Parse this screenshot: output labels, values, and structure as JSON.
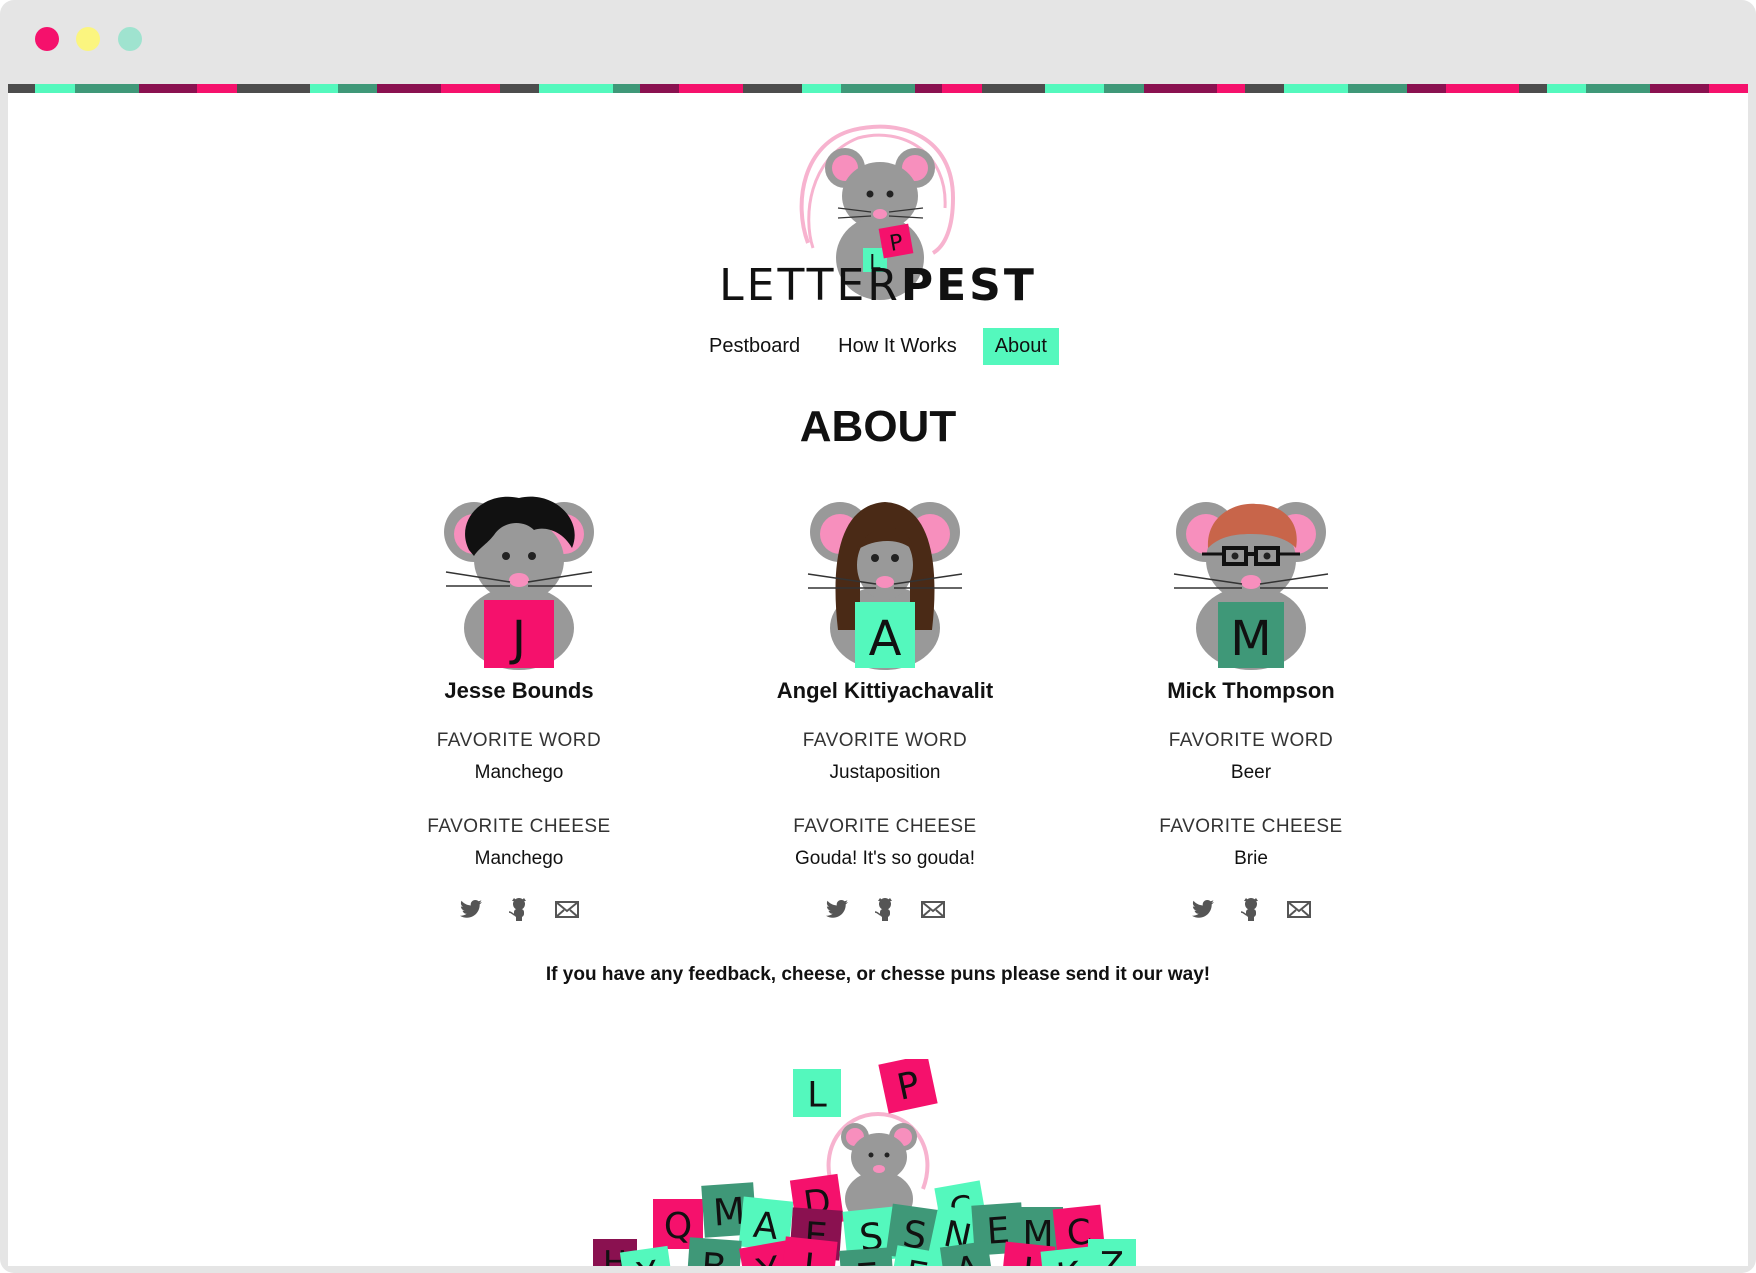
{
  "window": {
    "controls": [
      "close",
      "minimize",
      "zoom"
    ],
    "colors": {
      "close": "#f5116c",
      "minimize": "#fbf57f",
      "zoom": "#9fe3cf"
    }
  },
  "brand": {
    "wordmark_light": "LETTER",
    "wordmark_bold": "PEST",
    "logo_letters": [
      "L",
      "P"
    ],
    "colors": {
      "pink": "#f5116c",
      "mint": "#54f8bd",
      "green": "#3f9878",
      "maroon": "#8a1150",
      "gray": "#4d4d4d"
    }
  },
  "nav": {
    "items": [
      {
        "label": "Pestboard",
        "active": false
      },
      {
        "label": "How It Works",
        "active": false
      },
      {
        "label": "About",
        "active": true
      }
    ]
  },
  "main": {
    "title": "ABOUT",
    "members": [
      {
        "name": "Jesse Bounds",
        "letter": "J",
        "word_label": "FAVORITE WORD",
        "word": "Manchego",
        "cheese_label": "FAVORITE CHEESE",
        "cheese": "Manchego",
        "socials": [
          "twitter-icon",
          "github-icon",
          "mail-icon"
        ]
      },
      {
        "name": "Angel Kittiyachavalit",
        "letter": "A",
        "word_label": "FAVORITE WORD",
        "word": "Justaposition",
        "cheese_label": "FAVORITE CHEESE",
        "cheese": "Gouda! It's so gouda!",
        "socials": [
          "twitter-icon",
          "github-icon",
          "mail-icon"
        ]
      },
      {
        "name": "Mick Thompson",
        "letter": "M",
        "word_label": "FAVORITE WORD",
        "word": "Beer",
        "cheese_label": "FAVORITE CHEESE",
        "cheese": "Brie",
        "socials": [
          "twitter-icon",
          "github-icon",
          "mail-icon"
        ]
      }
    ],
    "feedback": "If you have any feedback, cheese, or chesse puns please send it our way!"
  },
  "footer_pile": {
    "held_letters": [
      "L",
      "P"
    ],
    "pile_letters": [
      "Q",
      "M",
      "A",
      "D",
      "E",
      "S",
      "S",
      "C",
      "N",
      "E",
      "M",
      "C",
      "H",
      "X",
      "B",
      "Y",
      "I",
      "E",
      "E",
      "A",
      "I",
      "K",
      "Z"
    ]
  }
}
